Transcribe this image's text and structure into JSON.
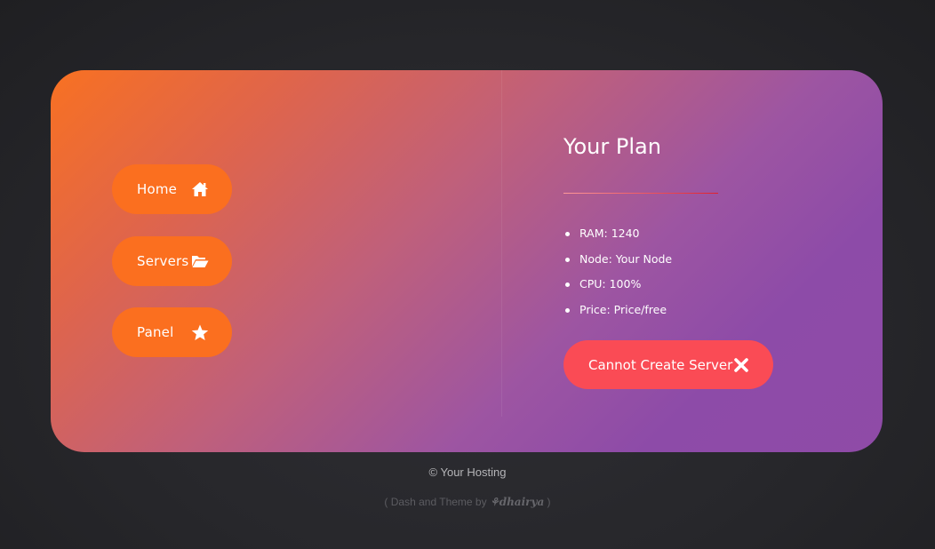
{
  "nav": {
    "items": [
      {
        "label": "Home",
        "icon": "home-icon"
      },
      {
        "label": "Servers",
        "icon": "folder-open-icon"
      },
      {
        "label": "Panel",
        "icon": "star-icon"
      }
    ]
  },
  "plan": {
    "title": "Your Plan",
    "specs": [
      "RAM: 1240",
      "Node: Your Node",
      "CPU: 100%",
      "Price: Price/free"
    ],
    "action_label": "Cannot Create Server",
    "action_icon": "close-icon"
  },
  "footer": {
    "copyright": "© Your Hosting",
    "credit_prefix": "( Dash and Theme by ",
    "credit_author": "⚘dhairya",
    "credit_suffix": " )"
  },
  "colors": {
    "nav_button": "#fb6f1f",
    "action_button": "#fa4b55",
    "gradient_start": "#f87122",
    "gradient_end": "#8f4ba7",
    "background": "#2a2a2e"
  }
}
